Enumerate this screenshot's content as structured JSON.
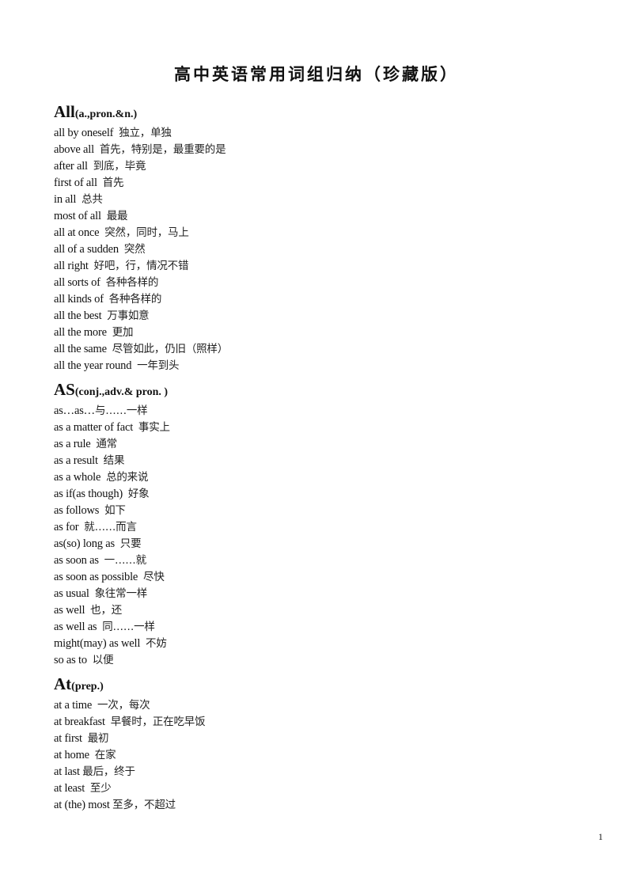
{
  "document": {
    "title": "高中英语常用词组归纳（珍藏版）",
    "page_number": "1"
  },
  "sections": [
    {
      "word": "All",
      "pos": "(a.,pron.&n.)",
      "entries": [
        {
          "en": "all by oneself",
          "sep": "  ",
          "zh": "独立，单独"
        },
        {
          "en": "above all",
          "sep": "  ",
          "zh": "首先，特别是，最重要的是"
        },
        {
          "en": "after all",
          "sep": "  ",
          "zh": "到底，毕竟"
        },
        {
          "en": "first of all",
          "sep": "  ",
          "zh": "首先"
        },
        {
          "en": "in all",
          "sep": "  ",
          "zh": "总共"
        },
        {
          "en": "most of all",
          "sep": "  ",
          "zh": "最最"
        },
        {
          "en": "all at once",
          "sep": "  ",
          "zh": "突然，同时，马上"
        },
        {
          "en": "all of a sudden",
          "sep": "  ",
          "zh": "突然"
        },
        {
          "en": "all right",
          "sep": "  ",
          "zh": "好吧，行，情况不错"
        },
        {
          "en": "all sorts of",
          "sep": "  ",
          "zh": "各种各样的"
        },
        {
          "en": "all kinds of",
          "sep": "  ",
          "zh": "各种各样的"
        },
        {
          "en": "all the best",
          "sep": "  ",
          "zh": "万事如意"
        },
        {
          "en": "all the more",
          "sep": "  ",
          "zh": "更加"
        },
        {
          "en": "all the same",
          "sep": "  ",
          "zh": "尽管如此，仍旧（照样）"
        },
        {
          "en": "all the year round",
          "sep": "  ",
          "zh": "一年到头"
        }
      ]
    },
    {
      "word": "AS",
      "pos": "(conj.,adv.& pron. )",
      "entries": [
        {
          "en": "as…as…",
          "sep": "",
          "zh": "与……一样"
        },
        {
          "en": "as a matter of fact",
          "sep": "  ",
          "zh": "事实上"
        },
        {
          "en": "as a rule",
          "sep": "  ",
          "zh": "通常"
        },
        {
          "en": "as a result",
          "sep": "  ",
          "zh": "结果"
        },
        {
          "en": "as a whole",
          "sep": "  ",
          "zh": "总的来说"
        },
        {
          "en": "as if(as though)",
          "sep": "  ",
          "zh": "好象"
        },
        {
          "en": "as follows",
          "sep": "  ",
          "zh": "如下"
        },
        {
          "en": "as for",
          "sep": "  ",
          "zh": "就……而言"
        },
        {
          "en": "as(so) long as",
          "sep": "  ",
          "zh": "只要"
        },
        {
          "en": "as soon as",
          "sep": "  ",
          "zh": "一……就"
        },
        {
          "en": "as soon as possible",
          "sep": "  ",
          "zh": "尽快"
        },
        {
          "en": "as usual",
          "sep": "  ",
          "zh": "象往常一样"
        },
        {
          "en": "as well",
          "sep": "  ",
          "zh": "也，还"
        },
        {
          "en": "as well as",
          "sep": "  ",
          "zh": "同……一样"
        },
        {
          "en": "might(may) as well",
          "sep": "  ",
          "zh": "不妨"
        },
        {
          "en": "so as to",
          "sep": "  ",
          "zh": "以便"
        }
      ]
    },
    {
      "word": "At",
      "pos": "(prep.)",
      "entries": [
        {
          "en": "at a time",
          "sep": "  ",
          "zh": "一次，每次"
        },
        {
          "en": "at breakfast",
          "sep": "  ",
          "zh": "早餐时，正在吃早饭"
        },
        {
          "en": "at first",
          "sep": "  ",
          "zh": "最初"
        },
        {
          "en": "at home",
          "sep": "  ",
          "zh": "在家"
        },
        {
          "en": "at last",
          "sep": " ",
          "zh": "最后，终于"
        },
        {
          "en": "at least",
          "sep": "  ",
          "zh": "至少"
        },
        {
          "en": "at (the) most",
          "sep": " ",
          "zh": "至多，不超过"
        }
      ]
    }
  ]
}
